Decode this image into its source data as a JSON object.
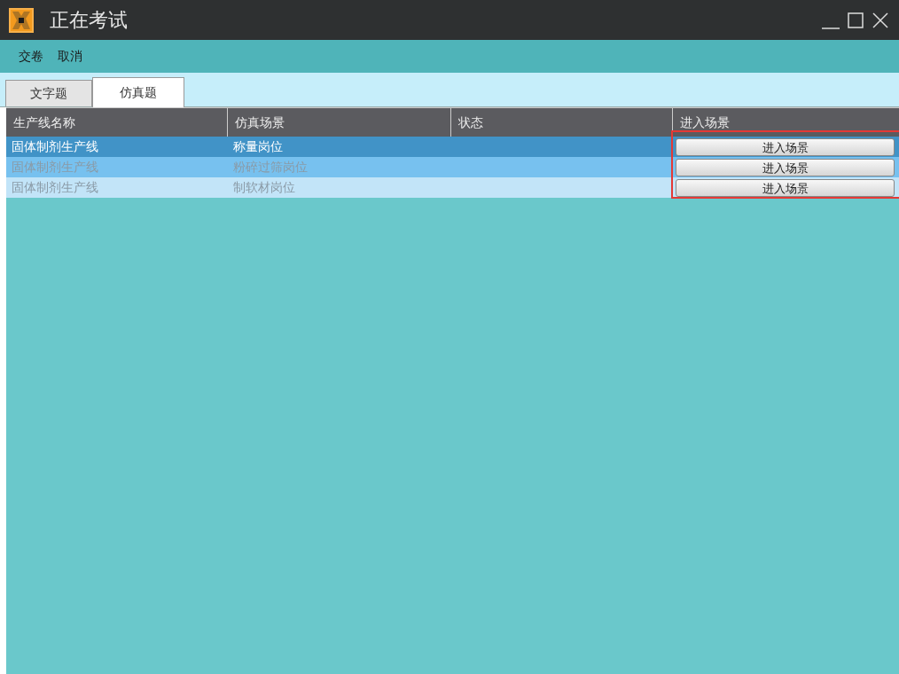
{
  "window": {
    "title": "正在考试"
  },
  "menu": [
    "交卷",
    "取消"
  ],
  "tabs": [
    {
      "label": "文字题",
      "selected": false
    },
    {
      "label": "仿真题",
      "selected": true
    }
  ],
  "table": {
    "columns": [
      "生产线名称",
      "仿真场景",
      "状态",
      "进入场景"
    ],
    "rows": [
      {
        "line": "固体制剂生产线",
        "scene": "称量岗位",
        "selected": true,
        "hovered": false,
        "button": "进入场景"
      },
      {
        "line": "固体制剂生产线",
        "scene": "粉碎过筛岗位",
        "selected": false,
        "hovered": true,
        "button": "进入场景"
      },
      {
        "line": "固体制剂生产线",
        "scene": "制软材岗位",
        "selected": false,
        "hovered": false,
        "button": "进入场景"
      }
    ]
  }
}
